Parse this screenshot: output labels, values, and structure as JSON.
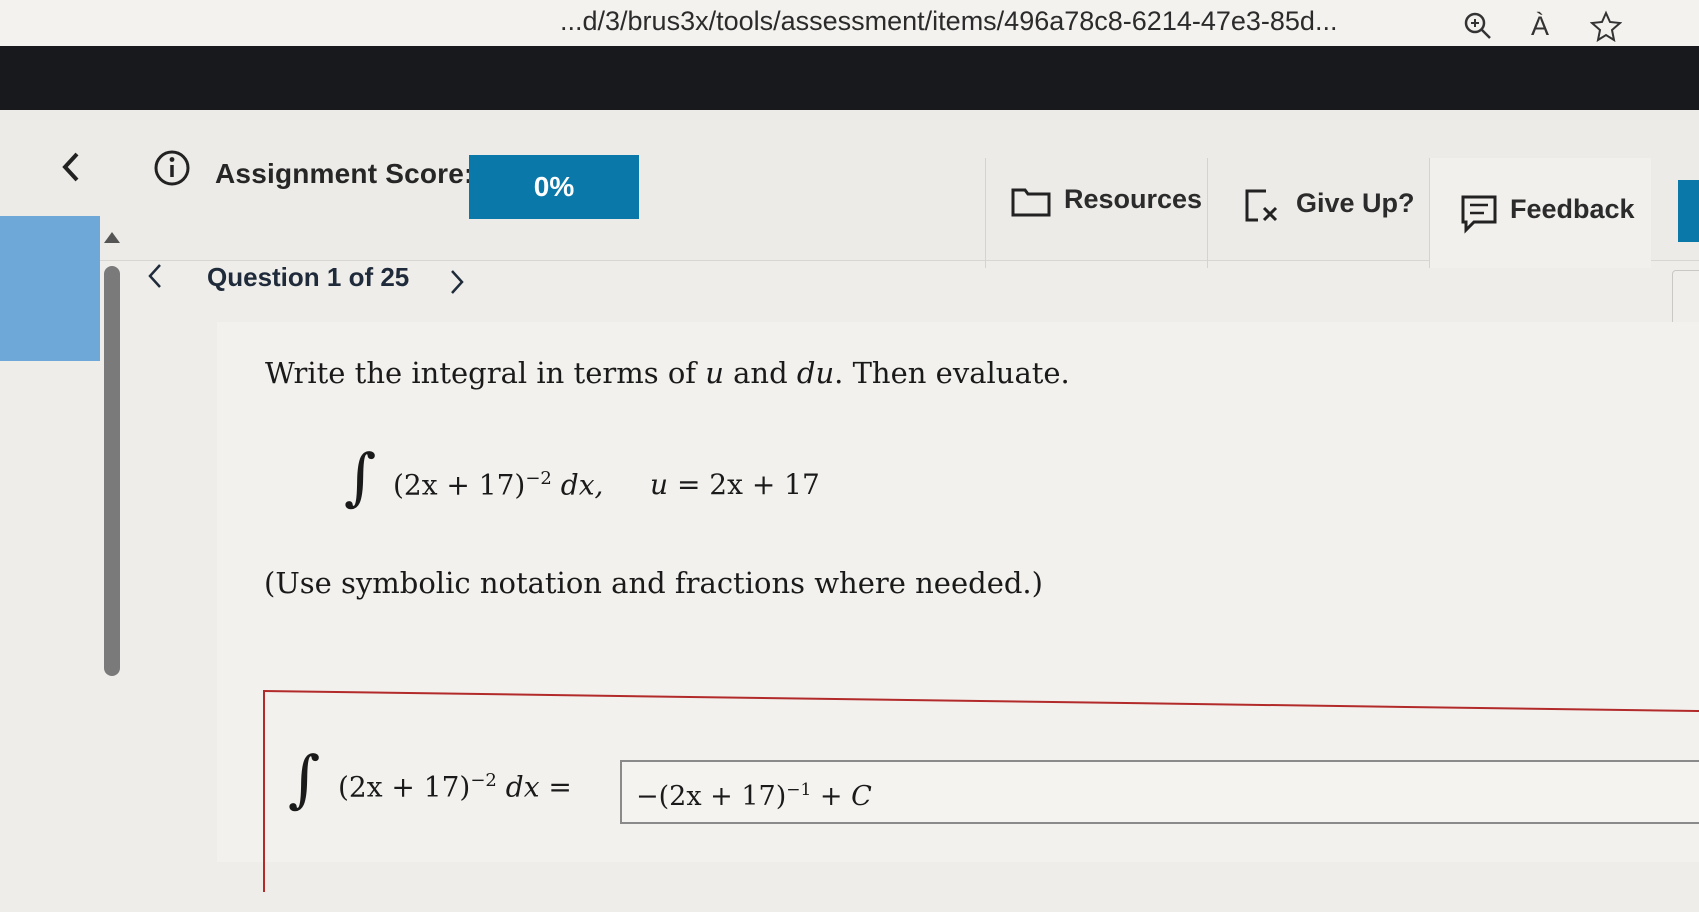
{
  "browser": {
    "url_text": "...d/3/brus3x/tools/assessment/items/496a78c8-6214-47e3-85d...",
    "icons": [
      "zoom-icon",
      "read-aloud-icon",
      "favorite-star-icon"
    ],
    "read_aloud_glyph": "À"
  },
  "header": {
    "score_label": "Assignment Score:",
    "score_value": "0%",
    "resources_label": "Resources",
    "give_up_label": "Give Up?",
    "feedback_label": "Feedback"
  },
  "question_nav": {
    "label": "Question 1 of 25"
  },
  "question": {
    "prompt_pre": "Write the integral in terms of ",
    "prompt_u": "u",
    "prompt_mid": " and ",
    "prompt_du": "du",
    "prompt_post": ". Then evaluate.",
    "integrand": "(2x + 17)",
    "exponent": "−2",
    "dx": " dx,",
    "substitution_var": "u",
    "substitution_rhs": " = 2x + 17",
    "hint": "(Use symbolic notation and fractions where needed.)"
  },
  "answer": {
    "lhs_integrand": "(2x + 17)",
    "lhs_exponent": "−2",
    "lhs_dx": " dx =",
    "value_prefix": "−(2x + 17)",
    "value_exponent": "−1",
    "value_suffix": " + C"
  },
  "colors": {
    "score_box": "#0a79a9",
    "dark_band": "#17191c",
    "answer_border": "#b22a2a",
    "left_rail": "#6ea8d9"
  }
}
